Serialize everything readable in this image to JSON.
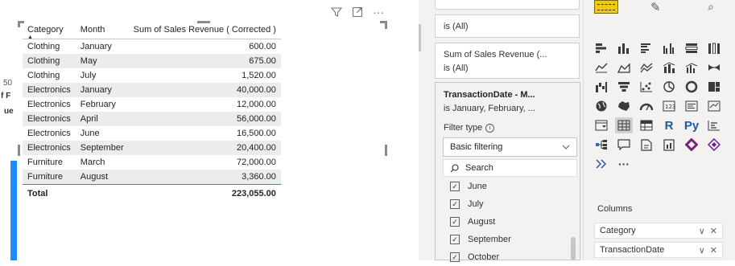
{
  "visual": {
    "header_icons": [
      "filter-icon",
      "focus-mode-icon",
      "more-options-icon"
    ],
    "more_glyph": "···",
    "peek_labels": [
      "50",
      "f F",
      "ue"
    ],
    "columns": [
      "Category",
      "Month",
      "Sum of Sales Revenue ( Corrected )"
    ],
    "rows": [
      {
        "category": "Clothing",
        "month": "January",
        "value": "600.00"
      },
      {
        "category": "Clothing",
        "month": "May",
        "value": "675.00"
      },
      {
        "category": "Clothing",
        "month": "July",
        "value": "1,520.00"
      },
      {
        "category": "Electronics",
        "month": "January",
        "value": "40,000.00"
      },
      {
        "category": "Electronics",
        "month": "February",
        "value": "12,000.00"
      },
      {
        "category": "Electronics",
        "month": "April",
        "value": "56,000.00"
      },
      {
        "category": "Electronics",
        "month": "June",
        "value": "16,500.00"
      },
      {
        "category": "Electronics",
        "month": "September",
        "value": "20,400.00"
      },
      {
        "category": "Furniture",
        "month": "March",
        "value": "72,000.00"
      },
      {
        "category": "Furniture",
        "month": "August",
        "value": "3,360.00"
      }
    ],
    "total": {
      "label": "Total",
      "value": "223,055.00"
    },
    "accent_color": "#1a8cff"
  },
  "filters": {
    "card1_text": "is (All)",
    "card2_title": "Sum of Sales Revenue (...",
    "card2_text": "is (All)",
    "card3_title": "TransactionDate - M...",
    "card3_text": "is January, February, ...",
    "filter_type_label": "Filter type",
    "filter_type_value": "Basic filtering",
    "search_placeholder": "Search",
    "months": [
      "June",
      "July",
      "August",
      "September",
      "October"
    ]
  },
  "visualizations": {
    "columns_label": "Columns",
    "wells": [
      "Category",
      "TransactionDate"
    ],
    "more_glyph": "···",
    "r_label": "R",
    "py_label": "Py"
  }
}
